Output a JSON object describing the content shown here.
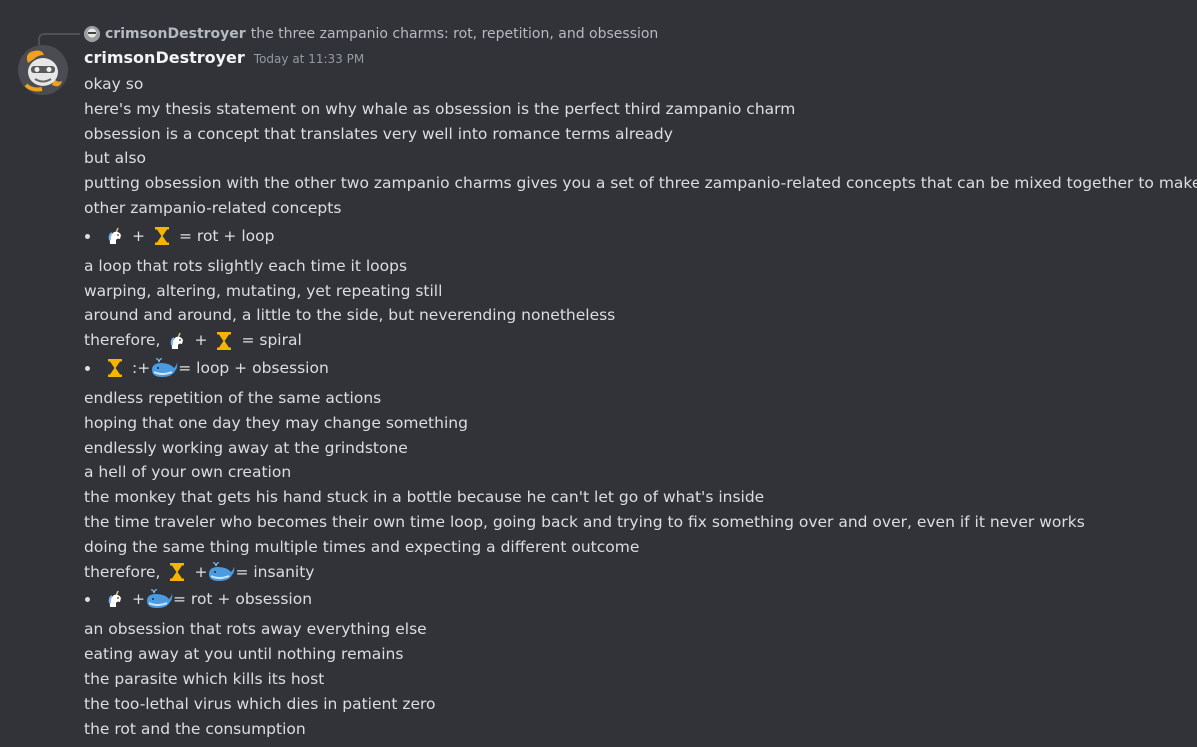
{
  "reply": {
    "author": "crimsonDestroyer",
    "content": "the three zampanio charms: rot, repetition, and obsession"
  },
  "message": {
    "author": "crimsonDestroyer",
    "timestamp": "Today at 11:33 PM",
    "lines_intro": [
      "okay so",
      "here's my thesis statement on why whale as obsession is the perfect third zampanio charm",
      "obsession is a concept that translates very well into romance terms already",
      "but also",
      "putting obsession with the other two zampanio charms gives you a set of three zampanio-related concepts that can be mixed together to make",
      "other zampanio-related concepts"
    ],
    "bullet1": {
      "plus": "+",
      "eq": "= rot + loop"
    },
    "lines_rot_loop": [
      "a loop that rots slightly each time it loops",
      "warping, altering, mutating, yet repeating still",
      "around and around, a little to the side, but neverending nonetheless"
    ],
    "therefore1": {
      "prefix": "therefore,",
      "plus": "+",
      "eq": "= spiral"
    },
    "bullet2": {
      "colon": ":",
      "plus": "+",
      "eq": "= loop + obsession"
    },
    "lines_loop_obsession": [
      "endless repetition of the same actions",
      "hoping that one day they may change something",
      "endlessly working away at the grindstone",
      "a hell of your own creation",
      "the monkey that gets his hand stuck in a bottle because he can't let go of what's inside",
      "the time traveler who becomes their own time loop, going back and trying to fix something over and over, even if it never works",
      "doing the same thing multiple times and expecting a different outcome"
    ],
    "therefore2": {
      "prefix": "therefore,",
      "plus": "+",
      "eq": "= insanity"
    },
    "bullet3": {
      "plus": "+",
      "eq": "= rot + obsession"
    },
    "lines_rot_obsession": [
      "an obsession that rots away everything else",
      "eating away at you until nothing remains",
      "the parasite which kills its host",
      "the too-lethal virus which dies in patient zero",
      "the rot and the consumption"
    ]
  },
  "icons": {
    "unicorn": "unicorn-icon",
    "hourglass": "hourglass-icon",
    "whale": "whale-icon"
  },
  "colors": {
    "background": "#313338",
    "text": "#dbdee1",
    "author": "#f2f3f5",
    "muted": "#949ba4",
    "hourglass": "#f4b400",
    "whale": "#4a9be0"
  }
}
